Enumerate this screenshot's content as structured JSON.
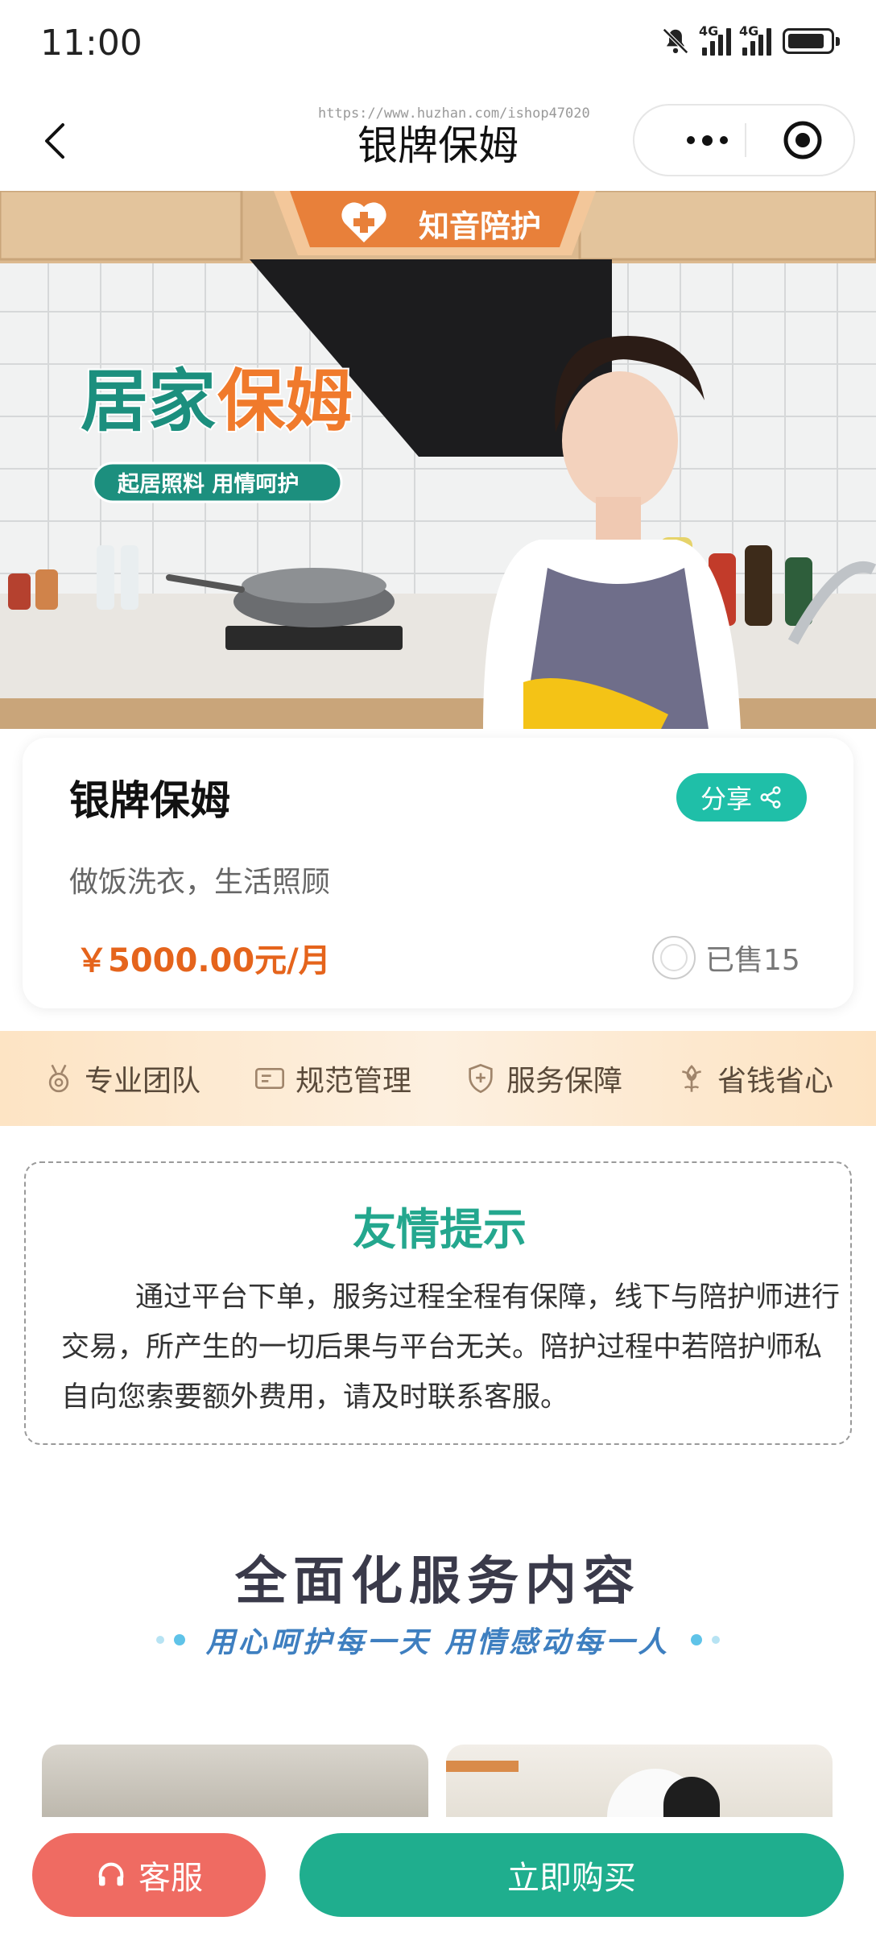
{
  "status_bar": {
    "time": "11:00",
    "network_1": "4G",
    "network_2": "4G"
  },
  "nav": {
    "title": "银牌保姆",
    "watermark": "https://www.huzhan.com/ishop47020"
  },
  "banner": {
    "brand": "知音陪护",
    "headline_part1": "居家",
    "headline_part2": "保姆",
    "tagline": "起居照料 用情呵护"
  },
  "product": {
    "title": "银牌保姆",
    "share_label": "分享",
    "description": "做饭洗衣，生活照顾",
    "price": "￥5000.00元/月",
    "sold": "已售15"
  },
  "features": [
    {
      "label": "专业团队",
      "icon": "medal-icon"
    },
    {
      "label": "规范管理",
      "icon": "card-icon"
    },
    {
      "label": "服务保障",
      "icon": "shield-icon"
    },
    {
      "label": "省钱省心",
      "icon": "flower-icon"
    }
  ],
  "tips": {
    "title": "友情提示",
    "body": "通过平台下单，服务过程全程有保障，线下与陪护师进行交易，所产生的一切后果与平台无关。陪护过程中若陪护师私自向您索要额外费用，请及时联系客服。"
  },
  "services": {
    "title": "全面化服务内容",
    "subtitle": "用心呵护每一天 用情感动每一人"
  },
  "bottom_bar": {
    "service_label": "客服",
    "buy_label": "立即购买"
  },
  "colors": {
    "accent": "#1fae8e",
    "teal": "#1fbfa8",
    "price": "#e5641c",
    "service_button": "#ef6b62"
  }
}
